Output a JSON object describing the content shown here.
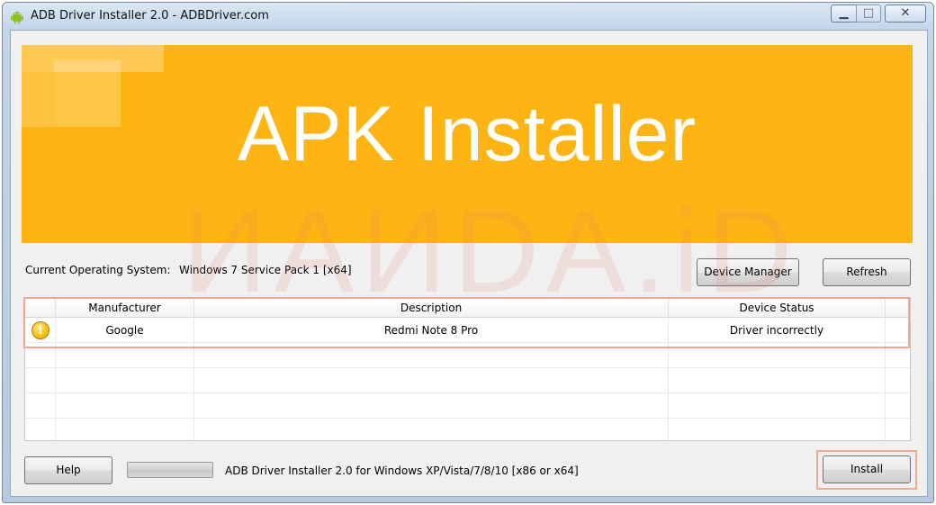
{
  "window": {
    "title": "ADB Driver Installer 2.0 - ADBDriver.com",
    "controls": {
      "minimize": "▁",
      "maximize": "□",
      "close": "✕"
    }
  },
  "banner": {
    "title": "APK Installer",
    "color": "#feb514"
  },
  "watermark": "ИAИDA.iD",
  "system": {
    "label": "Current Operating System:",
    "value": "Windows 7 Service Pack 1 [x64]"
  },
  "buttons": {
    "device_manager": "Device Manager",
    "refresh": "Refresh",
    "help": "Help",
    "install": "Install"
  },
  "table": {
    "columns": [
      "Manufacturer",
      "Description",
      "Device Status"
    ],
    "rows": [
      {
        "icon": "warning-icon",
        "manufacturer": "Google",
        "description": "Redmi Note 8 Pro",
        "status": "Driver incorrectly"
      }
    ]
  },
  "progress": {
    "value": 0
  },
  "footer": {
    "info": "ADB Driver Installer 2.0 for Windows XP/Vista/7/8/10 [x86 or x64]"
  },
  "colors": {
    "highlight": "#f2a78e",
    "warning": "#f5b800"
  }
}
